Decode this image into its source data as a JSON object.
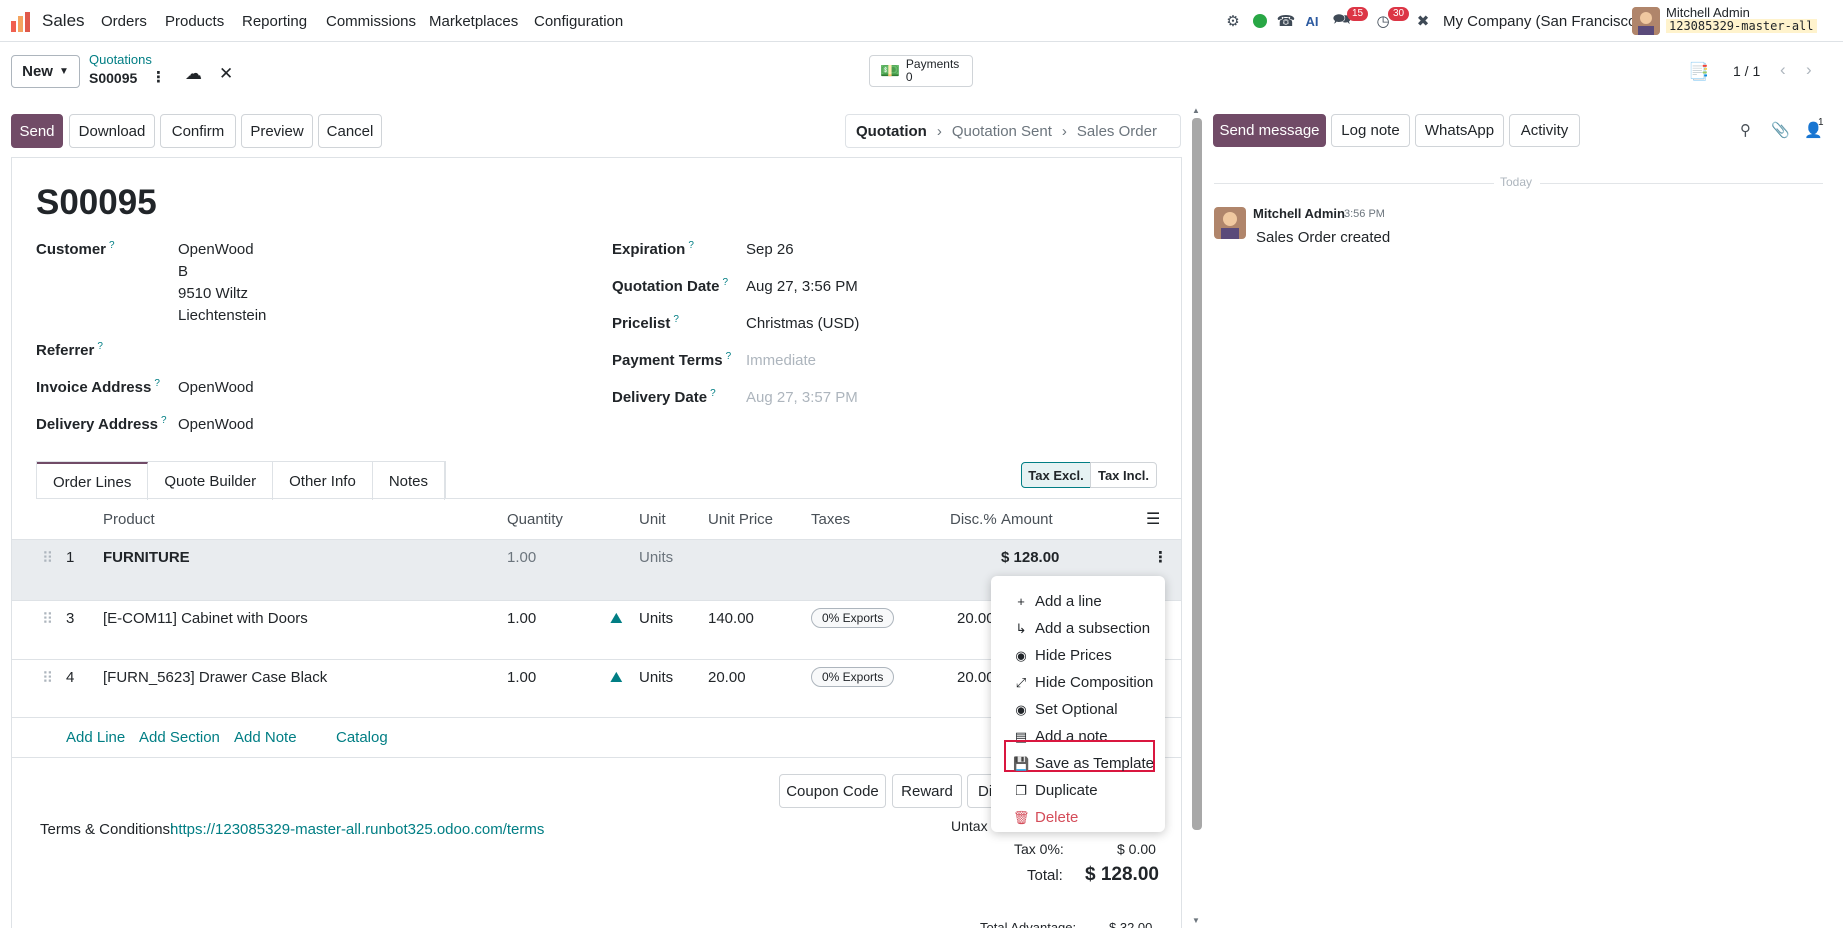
{
  "nav": {
    "app_name": "Sales",
    "menus": [
      "Orders",
      "Products",
      "Reporting",
      "Commissions",
      "Marketplaces",
      "Configuration"
    ],
    "messages_badge": "15",
    "activities_badge": "30",
    "company": "My Company (San Francisco)",
    "user_name": "Mitchell Admin",
    "db_name": "123085329-master-all"
  },
  "control": {
    "new_label": "New",
    "breadcrumb_parent": "Quotations",
    "record_name": "S00095",
    "payments_label": "Payments",
    "payments_count": "0",
    "pager": "1 / 1"
  },
  "actions": {
    "send": "Send",
    "download": "Download",
    "confirm": "Confirm",
    "preview": "Preview",
    "cancel": "Cancel"
  },
  "status": {
    "stages": [
      "Quotation",
      "Quotation Sent",
      "Sales Order"
    ],
    "active": "Quotation"
  },
  "form": {
    "title": "S00095",
    "customer_label": "Customer",
    "customer_lines": [
      "OpenWood",
      "B",
      "9510 Wiltz",
      "Liechtenstein"
    ],
    "referrer_label": "Referrer",
    "invoice_label": "Invoice Address",
    "invoice_value": "OpenWood",
    "delivery_addr_label": "Delivery Address",
    "delivery_addr_value": "OpenWood",
    "expiration_label": "Expiration",
    "expiration_value": "Sep 26",
    "qdate_label": "Quotation Date",
    "qdate_value": "Aug 27, 3:56 PM",
    "pricelist_label": "Pricelist",
    "pricelist_value": "Christmas (USD)",
    "terms_label": "Payment Terms",
    "terms_value": "Immediate",
    "ddate_label": "Delivery Date",
    "ddate_value": "Aug 27, 3:57 PM",
    "help": "?"
  },
  "tabs": [
    "Order Lines",
    "Quote Builder",
    "Other Info",
    "Notes"
  ],
  "tax_toggle": {
    "excl": "Tax Excl.",
    "incl": "Tax Incl."
  },
  "table": {
    "headers": {
      "product": "Product",
      "quantity": "Quantity",
      "unit": "Unit",
      "unit_price": "Unit Price",
      "taxes": "Taxes",
      "disc": "Disc.%",
      "amount": "Amount"
    },
    "section": {
      "seq": "1",
      "name": "FURNITURE",
      "qty": "1.00",
      "unit": "Units",
      "amount": "$ 128.00"
    },
    "rows": [
      {
        "seq": "3",
        "product": "[E-COM11] Cabinet with Doors",
        "qty": "1.00",
        "unit": "Units",
        "price": "140.00",
        "tax": "0% Exports",
        "disc": "20.00"
      },
      {
        "seq": "4",
        "product": "[FURN_5623] Drawer Case Black",
        "qty": "1.00",
        "unit": "Units",
        "price": "20.00",
        "tax": "0% Exports",
        "disc": "20.00"
      }
    ],
    "add_line": "Add Line",
    "add_section": "Add Section",
    "add_note": "Add Note",
    "catalog": "Catalog"
  },
  "footer_buttons": {
    "coupon": "Coupon Code",
    "reward": "Reward",
    "di": "Di"
  },
  "terms": {
    "label": "Terms & Conditions:",
    "url": "https://123085329-master-all.runbot325.odoo.com/terms"
  },
  "totals": {
    "untaxed_label": "Untax",
    "tax_label": "Tax 0%:",
    "tax_value": "$ 0.00",
    "total_label": "Total:",
    "total_value": "$ 128.00",
    "advantage_label": "Total Advantage:",
    "advantage_value": "$ 32.00"
  },
  "dropdown": {
    "items": [
      "Add a line",
      "Add a subsection",
      "Hide Prices",
      "Hide Composition",
      "Set Optional",
      "Add a note",
      "Save as Template",
      "Duplicate",
      "Delete"
    ],
    "highlighted": "Save as Template",
    "highlight_color": "#d9163f",
    "delete_color": "#d44c59"
  },
  "chatter": {
    "send_message": "Send message",
    "log_note": "Log note",
    "whatsapp": "WhatsApp",
    "activity": "Activity",
    "followers_count": "1",
    "today": "Today",
    "author": "Mitchell Admin",
    "time": "3:56 PM",
    "message": "Sales Order created"
  },
  "colors": {
    "primary": "#714b67",
    "link": "#017e84"
  }
}
